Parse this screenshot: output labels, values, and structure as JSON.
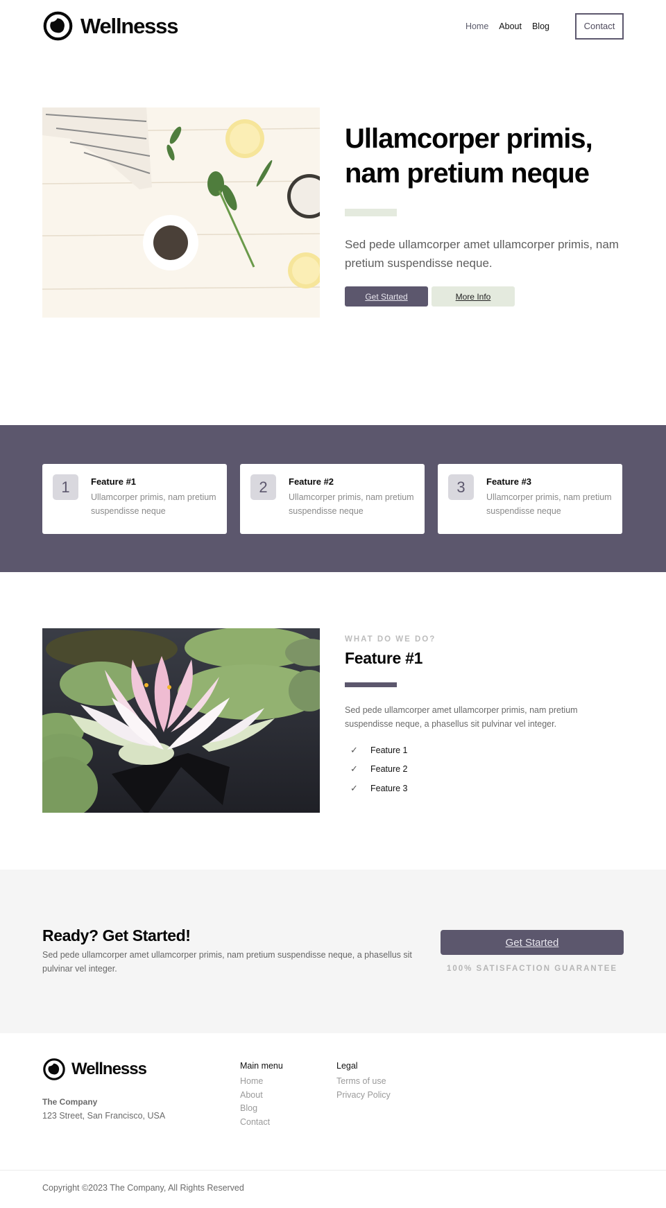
{
  "brand": {
    "name": "Wellnesss",
    "icon": "eye-circle-logo-icon"
  },
  "nav": {
    "items": [
      {
        "label": "Home"
      },
      {
        "label": "About"
      },
      {
        "label": "Blog"
      }
    ],
    "contact_label": "Contact"
  },
  "hero": {
    "image_alt": "Herbs, lemon, salt and spices on white wooden table",
    "title": "Ullamcorper primis, nam pretium neque",
    "description": "Sed pede ullamcorper amet ullamcorper primis, nam pretium suspendisse neque.",
    "primary_button": "Get Started",
    "secondary_button": "More Info"
  },
  "features": [
    {
      "number": "1",
      "title": "Feature #1",
      "description": "Ullamcorper primis, nam pretium suspendisse neque"
    },
    {
      "number": "2",
      "title": "Feature #2",
      "description": "Ullamcorper primis, nam pretium suspendisse neque"
    },
    {
      "number": "3",
      "title": "Feature #3",
      "description": "Ullamcorper primis, nam pretium suspendisse neque"
    }
  ],
  "what_we_do": {
    "image_alt": "Pink lotus flower on dark water with lily pads",
    "eyebrow": "WHAT DO WE DO?",
    "title": "Feature #1",
    "description": "Sed pede ullamcorper amet ullamcorper primis, nam pretium suspendisse neque, a phasellus sit pulvinar vel integer.",
    "checklist": [
      {
        "label": "Feature 1",
        "icon": "check-icon"
      },
      {
        "label": "Feature 2",
        "icon": "check-icon"
      },
      {
        "label": "Feature 3",
        "icon": "check-icon"
      }
    ]
  },
  "cta": {
    "title": "Ready? Get Started!",
    "description": "Sed pede ullamcorper amet ullamcorper primis, nam pretium suspendisse neque, a phasellus sit pulvinar vel integer.",
    "button": "Get Started",
    "guarantee": "100% SATISFACTION GUARANTEE"
  },
  "footer": {
    "company": "The Company",
    "address": "123 Street, San Francisco, USA",
    "main_menu": {
      "title": "Main menu",
      "links": [
        {
          "label": "Home"
        },
        {
          "label": "About"
        },
        {
          "label": "Blog"
        },
        {
          "label": "Contact"
        }
      ]
    },
    "legal": {
      "title": "Legal",
      "links": [
        {
          "label": "Terms of use"
        },
        {
          "label": "Privacy Policy"
        }
      ]
    },
    "copyright": "Copyright ©2023 The Company, All Rights Reserved"
  },
  "colors": {
    "primary": "#5c576d",
    "accent_light": "#e4eade",
    "cta_bg": "#f5f5f5"
  }
}
